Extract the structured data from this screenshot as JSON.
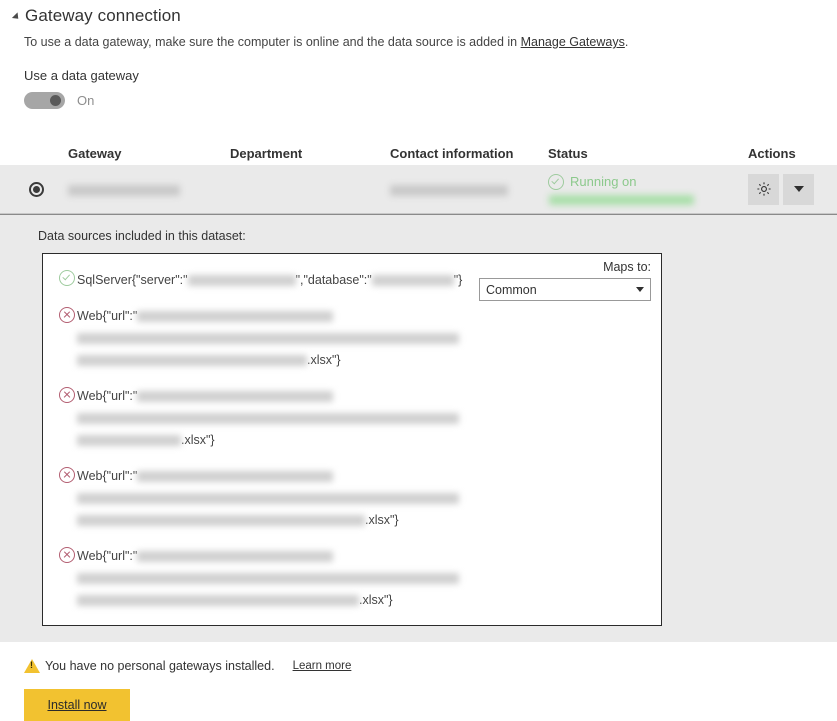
{
  "section": {
    "title": "Gateway connection",
    "description_prefix": "To use a data gateway, make sure the computer is online and the data source is added in ",
    "description_link": "Manage Gateways",
    "description_suffix": "."
  },
  "toggle": {
    "label": "Use a data gateway",
    "state": "On"
  },
  "table": {
    "columns": {
      "gateway": "Gateway",
      "department": "Department",
      "contact": "Contact information",
      "status": "Status",
      "actions": "Actions"
    },
    "row": {
      "gateway_name": "",
      "department": "",
      "contact": "",
      "status_text": "Running on",
      "status_detail": "",
      "settings_icon": "gear-icon",
      "expand_icon": "chevron-down-icon",
      "radio_selected": true
    }
  },
  "data_sources": {
    "heading": "Data sources included in this dataset:",
    "maps_to_label": "Maps to:",
    "maps_to_value": "Common",
    "items": [
      {
        "status_icon": "check-circle-icon",
        "prefix": "SqlServer{\"server\":\"",
        "middle": "\",\"database\":\"",
        "suffix": "\"}",
        "kind": "sql"
      },
      {
        "status_icon": "error-circle-icon",
        "prefix": "Web{\"url\":\"",
        "suffix": ".xlsx\"}",
        "kind": "web",
        "last_line_blur_width": 230
      },
      {
        "status_icon": "error-circle-icon",
        "prefix": "Web{\"url\":\"",
        "suffix": ".xlsx\"}",
        "kind": "web",
        "last_line_blur_width": 104
      },
      {
        "status_icon": "error-circle-icon",
        "prefix": "Web{\"url\":\"",
        "suffix": ".xlsx\"}",
        "kind": "web",
        "last_line_blur_width": 288
      },
      {
        "status_icon": "error-circle-icon",
        "prefix": "Web{\"url\":\"",
        "suffix": ".xlsx\"}",
        "kind": "web",
        "last_line_blur_width": 282
      }
    ]
  },
  "footer": {
    "warning_icon": "warning-triangle-icon",
    "warning_text": "You have no personal gateways installed.",
    "learn_more": "Learn more",
    "install_button": "Install now"
  },
  "colors": {
    "accent_yellow": "#f2c230",
    "status_green": "#8cc98c",
    "error_red": "#b35f72",
    "row_gray": "#eaeaea"
  }
}
